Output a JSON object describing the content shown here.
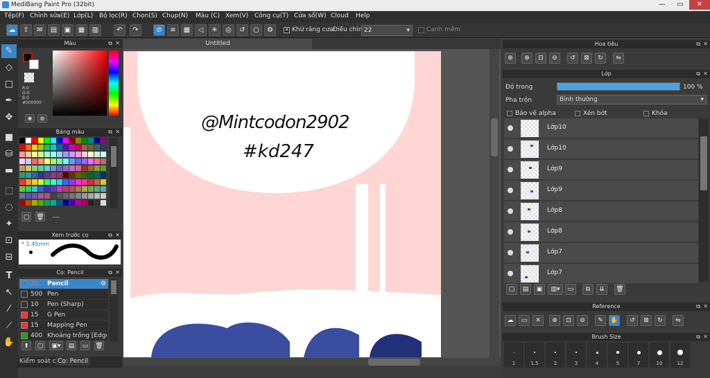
{
  "app": {
    "title": "MediBang Paint Pro (32bit)"
  },
  "menu": [
    "Tệp(F)",
    "Chỉnh sửa(E)",
    "Lớp(L)",
    "Bộ lọc(R)",
    "Chọn(S)",
    "Chụp(N)",
    "Màu (C)",
    "Xem(V)",
    "Công cụ(T)",
    "Cửa sổ(W)",
    "Cloud",
    "Help"
  ],
  "toolbar": {
    "antialias_label": "Khử răng cưa",
    "adjust_label": "Điều chỉnh",
    "adjust_value": "22",
    "snap_label": "Cạnh mềm"
  },
  "color_panel": {
    "title": "Màu",
    "rgb": [
      "R:0",
      "G:0",
      "B:0"
    ],
    "hex": "#000000"
  },
  "palette_panel": {
    "title": "Bảng màu",
    "footer": "---"
  },
  "preview_panel": {
    "title": "Xem trước cọ",
    "size": "1.45mm"
  },
  "brush_panel": {
    "title": "Cọ: Pencil",
    "items": [
      {
        "size": "20",
        "name": "Pencil",
        "color": "#ff6060"
      },
      {
        "size": "500",
        "name": "Pen",
        "color": "#333333"
      },
      {
        "size": "10",
        "name": "Pen (Sharp)",
        "color": "#333333"
      },
      {
        "size": "15",
        "name": "G Pen",
        "color": "#ff3030"
      },
      {
        "size": "15",
        "name": "Mapping Pen",
        "color": "#ff3030"
      },
      {
        "size": "400",
        "name": "Khoảng trống [Edge l",
        "color": "#20a020"
      }
    ]
  },
  "bottom_tabs": [
    "Kiểm soát cọ",
    "Cọ: Pencil"
  ],
  "canvas": {
    "tab": "Untitled",
    "text1": "@Mintcodon2902",
    "text2": "#kd247"
  },
  "navigator": {
    "title": "Hoa tiêu"
  },
  "layer_panel": {
    "title": "Lớp",
    "opacity_label": "Độ trong",
    "opacity_value": "100 %",
    "opacity": 1.0,
    "blend_label": "Pha trộn",
    "blend_value": "Bình thường",
    "protect_alpha": "Bảo vệ alpha",
    "clipping": "Xén bớt",
    "lock": "Khóa",
    "layers": [
      "Lớp10",
      "Lớp10",
      "Lớp9",
      "Lớp9",
      "Lớp8",
      "Lớp8",
      "Lớp7",
      "Lớp7"
    ]
  },
  "reference_panel": {
    "title": "Reference"
  },
  "brush_size_panel": {
    "title": "Brush Size",
    "sizes": [
      "1",
      "1.5",
      "2",
      "3",
      "4",
      "5",
      "7",
      "10",
      "12"
    ]
  },
  "colors": {
    "accent": "#3a87c8",
    "canvas_pink": "#ffd6d3",
    "blue_letters": "#3a4da0"
  }
}
